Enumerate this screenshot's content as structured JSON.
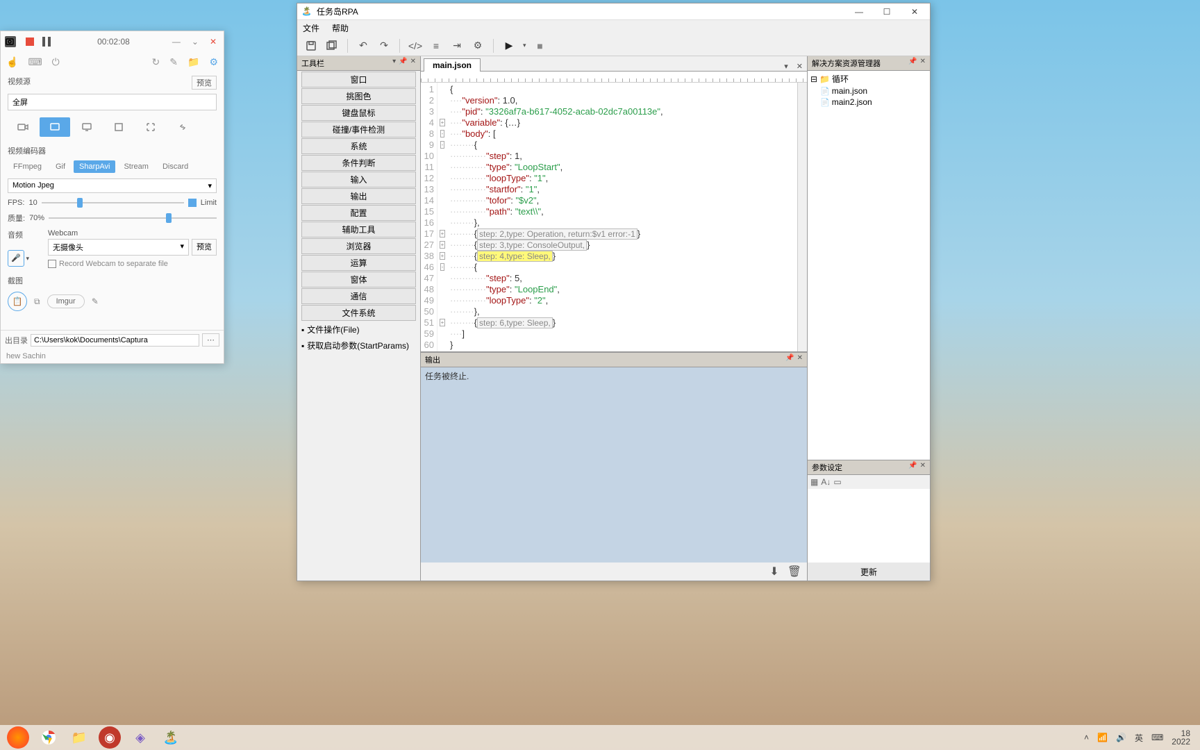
{
  "captura": {
    "timer": "00:02:08",
    "video_source_label": "视频源",
    "preview_btn": "预览",
    "source_value": "全屏",
    "encoder_label": "视频编码器",
    "tabs": {
      "ffmpeg": "FFmpeg",
      "gif": "Gif",
      "sharpavi": "SharpAvi",
      "stream": "Stream",
      "discard": "Discard"
    },
    "codec_value": "Motion Jpeg",
    "fps_label": "FPS:",
    "fps_value": "10",
    "limit_label": "Limit",
    "quality_label": "质量:",
    "quality_value": "70%",
    "audio_label": "音频",
    "webcam_label": "Webcam",
    "webcam_value": "无摄像头",
    "webcam_preview": "预览",
    "webcam_chk": "Record Webcam to separate file",
    "screenshot_label": "截图",
    "imgur": "Imgur",
    "outdir_label": "出目录",
    "outdir_value": "C:\\Users\\kok\\Documents\\Captura",
    "credit": "hew Sachin"
  },
  "rpa": {
    "title": "任务岛RPA",
    "menu": {
      "file": "文件",
      "help": "帮助"
    },
    "toolbox": {
      "title": "工具栏",
      "items": [
        "窗口",
        "挑图色",
        "键盘鼠标",
        "碰撞/事件检测",
        "系统",
        "条件判断",
        "输入",
        "输出",
        "配置",
        "辅助工具",
        "浏览器",
        "运算",
        "窗体",
        "通信",
        "文件系统"
      ],
      "tree": [
        {
          "label": "文件操作(File)"
        },
        {
          "label": "获取启动参数(StartParams)"
        }
      ]
    },
    "editor": {
      "tab": "main.json",
      "lines": [
        "1",
        "2",
        "3",
        "4",
        "8",
        "9",
        "10",
        "11",
        "12",
        "13",
        "14",
        "15",
        "16",
        "17",
        "27",
        "38",
        "46",
        "47",
        "48",
        "49",
        "50",
        "51",
        "59",
        "60"
      ],
      "fold_markers": {
        "4": "+",
        "8": "-",
        "9": "-",
        "17": "+",
        "27": "+",
        "38": "+",
        "46": "-",
        "51": "+"
      },
      "code_rows": [
        {
          "txt": "{"
        },
        {
          "ind": 1,
          "key": "version",
          "rest": ": 1.0,"
        },
        {
          "ind": 1,
          "key": "pid",
          "str": "3326af7a-b617-4052-acab-02dc7a00113e",
          "tail": ","
        },
        {
          "ind": 1,
          "key": "variable",
          "rest": ": {…}"
        },
        {
          "ind": 1,
          "key": "body",
          "rest": ": ["
        },
        {
          "ind": 2,
          "txt": "{"
        },
        {
          "ind": 3,
          "key": "step",
          "rest": ": 1,"
        },
        {
          "ind": 3,
          "key": "type",
          "str": "LoopStart",
          "tail": ","
        },
        {
          "ind": 3,
          "key": "loopType",
          "str": "1",
          "tail": ","
        },
        {
          "ind": 3,
          "key": "startfor",
          "str": "1",
          "tail": ","
        },
        {
          "ind": 3,
          "key": "tofor",
          "str": "$v2",
          "tail": ","
        },
        {
          "ind": 3,
          "key": "path",
          "str": "text\\\\",
          "tail": ","
        },
        {
          "ind": 2,
          "txt": "},"
        },
        {
          "ind": 2,
          "fold": "{step: 2,type: Operation, return:$v1 error:-1}"
        },
        {
          "ind": 2,
          "fold": "{step: 3,type: ConsoleOutput,}"
        },
        {
          "ind": 2,
          "fold_hl": "{step: 4,type: Sleep,}"
        },
        {
          "ind": 2,
          "txt": "{"
        },
        {
          "ind": 3,
          "key": "step",
          "rest": ": 5,"
        },
        {
          "ind": 3,
          "key": "type",
          "str": "LoopEnd",
          "tail": ","
        },
        {
          "ind": 3,
          "key": "loopType",
          "str": "2",
          "tail": ","
        },
        {
          "ind": 2,
          "txt": "},"
        },
        {
          "ind": 2,
          "fold": "{step: 6,type: Sleep,}"
        },
        {
          "ind": 1,
          "txt": "]"
        },
        {
          "txt": "}"
        }
      ]
    },
    "output": {
      "title": "输出",
      "text": "任务被终止."
    },
    "solution": {
      "title": "解决方案资源管理器",
      "root": "循环",
      "files": [
        "main.json",
        "main2.json"
      ]
    },
    "params": {
      "title": "参数设定",
      "update_btn": "更新"
    }
  },
  "taskbar": {
    "tray": {
      "ime": "英",
      "date_top": "18",
      "date_bot": "2022"
    }
  }
}
